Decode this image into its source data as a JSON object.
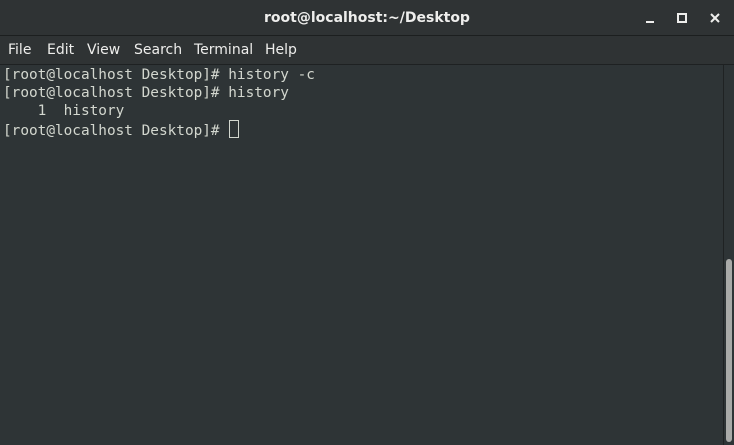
{
  "window": {
    "title": "root@localhost:~/Desktop"
  },
  "menubar": {
    "items": [
      {
        "label": "File"
      },
      {
        "label": "Edit"
      },
      {
        "label": "View"
      },
      {
        "label": "Search"
      },
      {
        "label": "Terminal"
      },
      {
        "label": "Help"
      }
    ]
  },
  "terminal": {
    "lines": [
      "[root@localhost Desktop]# history -c",
      "[root@localhost Desktop]# history",
      "    1  history",
      "[root@localhost Desktop]# "
    ]
  },
  "colors": {
    "background": "#2e3436",
    "text": "#d3d7cf",
    "chrome": "#2f3334"
  },
  "icons": {
    "minimize": "minimize-icon",
    "maximize": "maximize-icon",
    "close": "close-icon"
  }
}
